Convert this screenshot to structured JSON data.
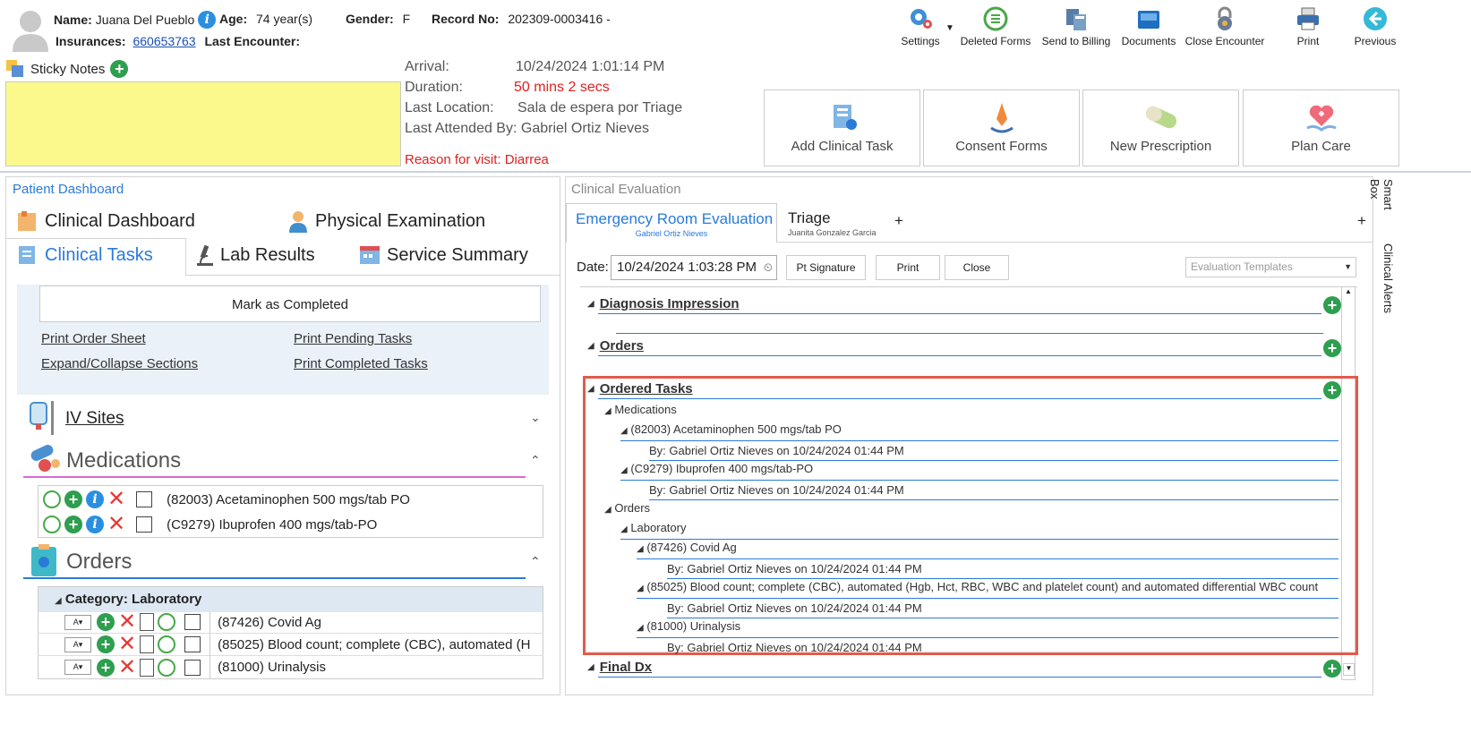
{
  "header": {
    "name_label": "Name:",
    "name_value": "Juana Del Pueblo",
    "age_label": "Age:",
    "age_value": "74 year(s)",
    "gender_label": "Gender:",
    "gender_value": "F",
    "record_label": "Record No:",
    "record_value": "202309-0003416 -",
    "insurances_label": "Insurances:",
    "insurances_value": "660653763",
    "last_encounter_label": "Last Encounter:"
  },
  "toolbar": [
    {
      "label": "Settings",
      "icon": "gear-icon"
    },
    {
      "label": "Deleted Forms",
      "icon": "restore-icon"
    },
    {
      "label": "Send to Billing",
      "icon": "billing-icon"
    },
    {
      "label": "Documents",
      "icon": "tray-icon"
    },
    {
      "label": "Close Encounter",
      "icon": "lock-icon"
    },
    {
      "label": "Print",
      "icon": "printer-icon"
    },
    {
      "label": "Previous",
      "icon": "back-arrow-icon"
    }
  ],
  "sticky_notes": {
    "label": "Sticky Notes"
  },
  "encounter": {
    "arrival_label": "Arrival:",
    "arrival_value": "10/24/2024 1:01:14 PM",
    "duration_label": "Duration:",
    "duration_value": "50 mins 2 secs",
    "location_label": "Last Location:",
    "location_value": "Sala de espera por Triage",
    "attended_label": "Last Attended By:",
    "attended_value": "Gabriel Ortiz Nieves",
    "reason": "Reason for visit: Diarrea"
  },
  "actions": [
    {
      "label": "Add Clinical Task"
    },
    {
      "label": "Consent Forms"
    },
    {
      "label": "New Prescription"
    },
    {
      "label": "Plan Care"
    }
  ],
  "left": {
    "title": "Patient Dashboard",
    "tabs": [
      {
        "label": "Clinical Dashboard"
      },
      {
        "label": "Physical Examination"
      },
      {
        "label": "Clinical Tasks"
      },
      {
        "label": "Lab Results"
      },
      {
        "label": "Service Summary"
      }
    ],
    "mark_completed": "Mark as Completed",
    "links": [
      "Print Order Sheet",
      "Print Pending Tasks",
      "Expand/Collapse Sections",
      "Print Completed Tasks"
    ],
    "iv_sites": "IV Sites",
    "medications_title": "Medications",
    "medications": [
      "(82003) Acetaminophen 500 mgs/tab PO",
      "(C9279) Ibuprofen 400 mgs/tab-PO"
    ],
    "orders_title": "Orders",
    "orders_category": "Category: Laboratory",
    "orders": [
      "(87426) Covid Ag",
      "(85025) Blood count; complete (CBC), automated (H",
      "(81000) Urinalysis"
    ]
  },
  "right": {
    "title": "Clinical Evaluation",
    "tabs": [
      {
        "label": "Emergency Room Evaluation",
        "sub": "Gabriel Ortiz Nieves"
      },
      {
        "label": "Triage",
        "sub": "Juanita Gonzalez Garcia"
      }
    ],
    "plus": "+",
    "date_label": "Date:",
    "date_value": "10/24/2024 1:03:28 PM",
    "btn_signature": "Pt Signature",
    "btn_print": "Print",
    "btn_close": "Close",
    "templates_placeholder": "Evaluation Templates",
    "sections": {
      "diagnosis": "Diagnosis Impression",
      "orders": "Orders",
      "ordered_tasks": "Ordered Tasks",
      "final_dx": "Final Dx"
    },
    "tree": {
      "medications": "Medications",
      "med1": "(82003) Acetaminophen 500 mgs/tab PO",
      "med2": "(C9279) Ibuprofen 400 mgs/tab-PO",
      "by": "By: Gabriel Ortiz Nieves on 10/24/2024 01:44 PM",
      "orders": "Orders",
      "laboratory": "Laboratory",
      "lab1": "(87426) Covid Ag",
      "lab2": "(85025) Blood count; complete (CBC), automated (Hgb, Hct, RBC, WBC and platelet count) and automated differential WBC count",
      "lab3": "(81000) Urinalysis"
    }
  },
  "side_tabs": [
    "Smart Box",
    "Clinical Alerts"
  ],
  "colors": {
    "highlight": "#e25a4a",
    "sticky": "#fbf98c",
    "accent": "#2a7ad8",
    "red_text": "#e02020"
  }
}
